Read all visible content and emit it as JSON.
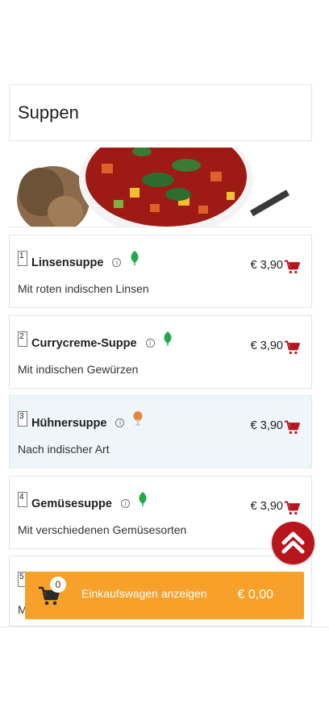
{
  "section": {
    "title": "Suppen"
  },
  "hero": {
    "alt": "food-photo-soup-bowl-with-bread"
  },
  "items": [
    {
      "number": "1",
      "name": "Linsensuppe",
      "description": "Mit roten indischen Linsen",
      "price": "€ 3,90",
      "diet_icon": "leaf-icon",
      "highlighted": false
    },
    {
      "number": "2",
      "name": "Currycreme-Suppe",
      "description": "Mit indischen Gewürzen",
      "price": "€ 3,90",
      "diet_icon": "leaf-icon",
      "highlighted": false
    },
    {
      "number": "3",
      "name": "Hühnersuppe",
      "description": "Nach indischer Art",
      "price": "€ 3,90",
      "diet_icon": "chicken-leg-icon",
      "highlighted": true
    },
    {
      "number": "4",
      "name": "Gemüsesuppe",
      "description": "Mit verschiedenen Gemüsesorten",
      "price": "€ 3,90",
      "diet_icon": "leaf-icon",
      "highlighted": false
    },
    {
      "number": "5",
      "name": "",
      "description": "M",
      "price": "",
      "diet_icon": "",
      "highlighted": false
    }
  ],
  "cart": {
    "count": "0",
    "label": "Einkaufswagen anzeigen",
    "total": "€ 0,00"
  },
  "info_glyph": "i",
  "colors": {
    "accent_red": "#b9151d",
    "cart_orange": "#f7a12a",
    "leaf_green": "#1faa4a",
    "chicken_orange": "#e38a3a",
    "highlight_bg": "#eef6f9"
  }
}
